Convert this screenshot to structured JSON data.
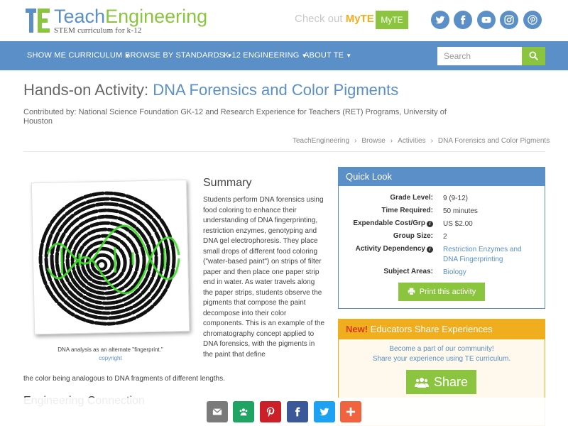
{
  "header": {
    "logo_teach": "Teach",
    "logo_engineering": "Engineering",
    "logo_tagline": "STEM curriculum for k-12",
    "checkout_prefix": "Check out",
    "checkout_myte": "MyTE",
    "myte_button": "MyTE",
    "social_icons": [
      "twitter-icon",
      "facebook-icon",
      "youtube-icon",
      "instagram-icon",
      "pinterest-icon"
    ]
  },
  "nav": {
    "items": [
      {
        "label": "SHOW ME CURRICULUM"
      },
      {
        "label": "BROWSE BY STANDARDS"
      },
      {
        "label": "K-12 ENGINEERING"
      },
      {
        "label": "ABOUT TE"
      }
    ],
    "search_placeholder": "Search"
  },
  "page": {
    "title_prefix": "Hands-on Activity:",
    "title_name": "DNA Forensics and Color Pigments",
    "contributed": "Contributed by: National Science Foundation GK-12 and Research Experience for Teachers (RET) Programs, University of Houston",
    "breadcrumb": [
      "TeachEngineering",
      "Browse",
      "Activities",
      "DNA Forensics and Color Pigments"
    ]
  },
  "figure": {
    "caption": "DNA analysis as an alternate \"fingerprint.\"",
    "link": "copyright"
  },
  "summary": {
    "title": "Summary",
    "text": "Students perform DNA forensics using food coloring to enhance their understanding of DNA fingerprinting, restriction enzymes, genotyping and DNA gel electrophoresis. They place small drops of different food coloring (\"water-based paint\") on strips of filter paper and then place one paper strip end in water. As water travels along the paper strips, students observe the pigments that compose the paint decompose into their color components. This is an example of the chromatography concept applied to DNA forensics, with the pigments in the paint that define",
    "tail": "the color being analogous to DNA fragments of different lengths.",
    "next_heading": "Engineering Connection"
  },
  "quick_look": {
    "title": "Quick Look",
    "rows": [
      {
        "label": "Grade Level:",
        "value": "9 (9-12)"
      },
      {
        "label": "Time Required:",
        "value": "50 minutes"
      },
      {
        "label": "Expendable Cost/Grp",
        "value": "US $2.00"
      },
      {
        "label": "Group Size:",
        "value": "2"
      },
      {
        "label": "Activity Dependency",
        "value": "Restriction Enzymes and DNA Fingerprinting"
      },
      {
        "label": "Subject Areas:",
        "value": "Biology"
      }
    ],
    "print_button": "Print this activity"
  },
  "educators": {
    "new_label": "New!",
    "title": "Educators Share Experiences",
    "line1": "Become a part of our community!",
    "line2": "Share your experience using TE curriculum.",
    "share_button": "Share"
  },
  "share_bar": {
    "buttons": [
      "email-icon",
      "google-classroom-icon",
      "pinterest-icon",
      "facebook-icon",
      "twitter-icon",
      "more-icon"
    ]
  },
  "colors": {
    "blue": "#5b8fc7",
    "green": "#8bc53f",
    "orange": "#f0ad1e"
  }
}
